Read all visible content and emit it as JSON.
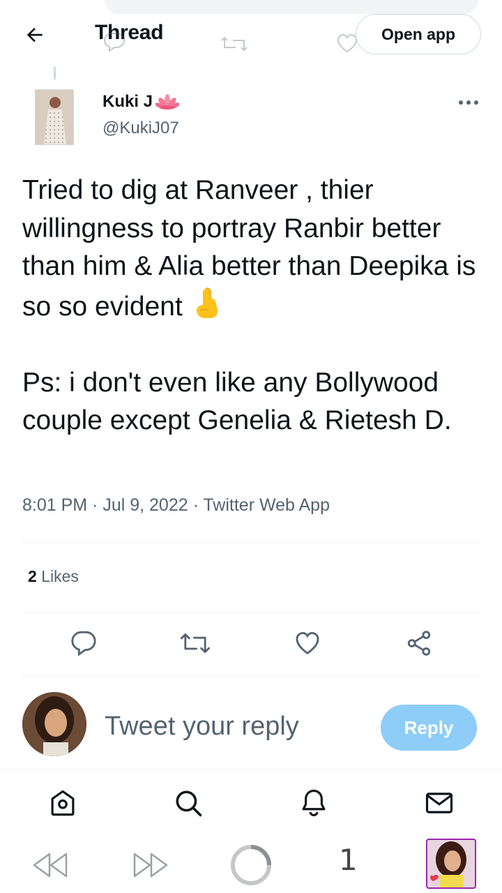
{
  "header": {
    "title": "Thread",
    "open_app_label": "Open app"
  },
  "tweet": {
    "author_name": "Kuki J",
    "author_handle": "@KukiJ07",
    "text_paragraph_1": "Tried to dig at Ranveer , thier willingness to portray Ranbir better than him & Alia better than Deepika is so so evident",
    "text_paragraph_2": "Ps: i don't even like any Bollywood couple except Genelia & Rietesh D.",
    "timestamp": "8:01 PM · Jul 9, 2022 · Twitter Web App",
    "likes_count": "2",
    "likes_label": "Likes"
  },
  "reply": {
    "placeholder": "Tweet your reply",
    "button_label": "Reply"
  },
  "bottom_nav": [
    "home-icon",
    "search-icon",
    "notifications-icon",
    "messages-icon"
  ],
  "browser": {
    "tab_count": "1"
  },
  "colors": {
    "text": "#0f1419",
    "secondary": "#536471",
    "reply_button": "#8ecdf7",
    "divider": "#eff3f4",
    "tab_thumb_border": "#9c27b0"
  }
}
